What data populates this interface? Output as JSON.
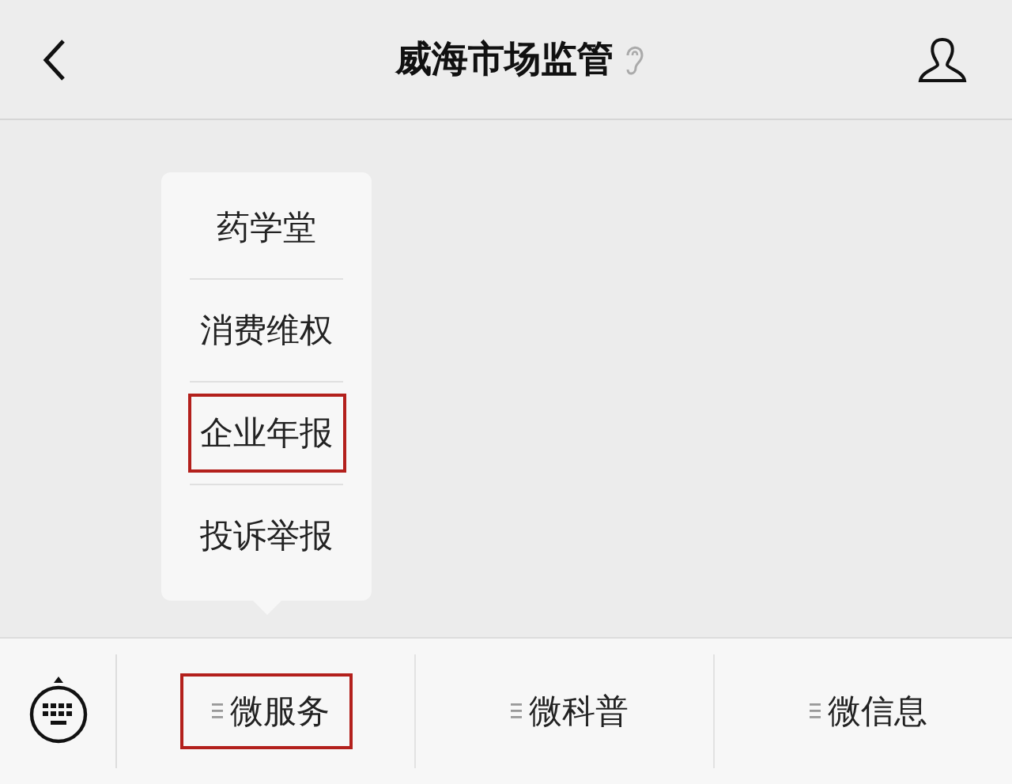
{
  "header": {
    "title": "威海市场监管"
  },
  "popup_menu": {
    "items": [
      {
        "label": "药学堂",
        "highlighted": false
      },
      {
        "label": "消费维权",
        "highlighted": false
      },
      {
        "label": "企业年报",
        "highlighted": true
      },
      {
        "label": "投诉举报",
        "highlighted": false
      }
    ]
  },
  "bottom_menu": {
    "tabs": [
      {
        "label": "微服务",
        "highlighted": true
      },
      {
        "label": "微科普",
        "highlighted": false
      },
      {
        "label": "微信息",
        "highlighted": false
      }
    ]
  }
}
